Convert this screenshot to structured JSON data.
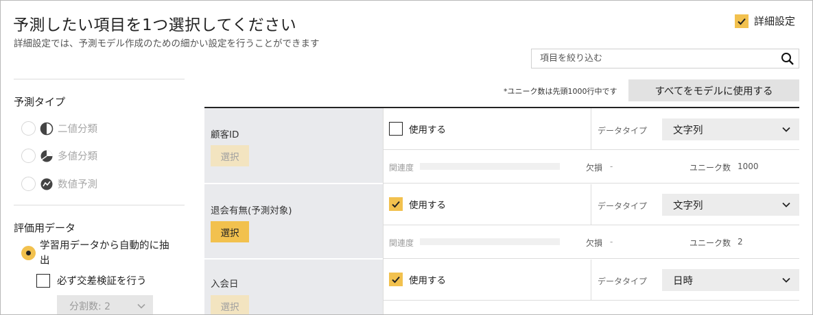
{
  "header": {
    "title": "予測したい項目を1つ選択してください",
    "subtitle": "詳細設定では、予測モデル作成のための細かい設定を行うことができます",
    "advanced_label": "詳細設定",
    "advanced_checked": true
  },
  "search": {
    "placeholder": "項目を絞り込む",
    "icon": "search-icon"
  },
  "note": "*ユニーク数は先頭1000行中です",
  "use_all_label": "すべてをモデルに使用する",
  "prediction_type": {
    "title": "予測タイプ",
    "options": [
      {
        "label": "二値分類",
        "icon": "half-circle-icon"
      },
      {
        "label": "多値分類",
        "icon": "pie-chart-icon"
      },
      {
        "label": "数値予測",
        "icon": "chart-circle-icon"
      }
    ]
  },
  "eval_data": {
    "title": "評価用データ",
    "option_label": "学習用データから自動的に抽出",
    "cross_validation_label": "必ず交差検証を行う",
    "folds_label": "分割数: 2"
  },
  "columns": [
    {
      "name": "顧客ID",
      "select_label": "選択",
      "selectable": false,
      "use_label": "使用する",
      "used": false,
      "datatype_label": "データタイプ",
      "datatype": "文字列",
      "relevance_label": "関連度",
      "missing_label": "欠損",
      "missing": "-",
      "unique_label": "ユニーク数",
      "unique": "1000"
    },
    {
      "name": "退会有無(予測対象)",
      "select_label": "選択",
      "selectable": true,
      "use_label": "使用する",
      "used": true,
      "datatype_label": "データタイプ",
      "datatype": "文字列",
      "relevance_label": "関連度",
      "missing_label": "欠損",
      "missing": "-",
      "unique_label": "ユニーク数",
      "unique": "2"
    },
    {
      "name": "入会日",
      "select_label": "選択",
      "selectable": false,
      "use_label": "使用する",
      "used": true,
      "datatype_label": "データタイプ",
      "datatype": "日時"
    }
  ],
  "colors": {
    "accent": "#f2c14e",
    "accent_light": "#f3e4c0",
    "name_cell_bg": "#e9eaed",
    "select_bg": "#ececec"
  }
}
